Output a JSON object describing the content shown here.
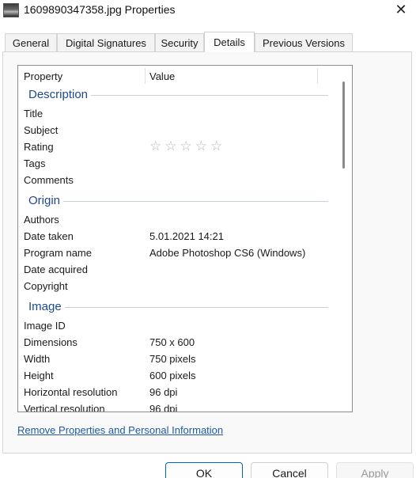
{
  "window": {
    "title": "1609890347358.jpg Properties",
    "icon": "image-file-icon",
    "close_glyph": "✕"
  },
  "tabs": [
    {
      "label": "General"
    },
    {
      "label": "Digital Signatures"
    },
    {
      "label": "Security"
    },
    {
      "label": "Details",
      "active": true
    },
    {
      "label": "Previous Versions"
    }
  ],
  "details": {
    "header": {
      "property": "Property",
      "value": "Value"
    },
    "sections": [
      {
        "name": "Description",
        "rows": [
          {
            "key": "Title",
            "value": ""
          },
          {
            "key": "Subject",
            "value": ""
          },
          {
            "key": "Rating",
            "value": "",
            "stars": 0,
            "max_stars": 5
          },
          {
            "key": "Tags",
            "value": ""
          },
          {
            "key": "Comments",
            "value": ""
          }
        ]
      },
      {
        "name": "Origin",
        "rows": [
          {
            "key": "Authors",
            "value": ""
          },
          {
            "key": "Date taken",
            "value": "5.01.2021 14:21"
          },
          {
            "key": "Program name",
            "value": "Adobe Photoshop CS6 (Windows)"
          },
          {
            "key": "Date acquired",
            "value": ""
          },
          {
            "key": "Copyright",
            "value": ""
          }
        ]
      },
      {
        "name": "Image",
        "rows": [
          {
            "key": "Image ID",
            "value": ""
          },
          {
            "key": "Dimensions",
            "value": "750 x 600"
          },
          {
            "key": "Width",
            "value": "750 pixels"
          },
          {
            "key": "Height",
            "value": "600 pixels"
          },
          {
            "key": "Horizontal resolution",
            "value": "96 dpi"
          },
          {
            "key": "Vertical resolution",
            "value": "96 dpi"
          }
        ]
      }
    ]
  },
  "remove_link": "Remove Properties and Personal Information",
  "buttons": {
    "ok": "OK",
    "cancel": "Cancel",
    "apply": "Apply"
  },
  "colors": {
    "accent": "#0067c0",
    "section_heading": "#1e4a8a",
    "link": "#1f5aa6"
  }
}
